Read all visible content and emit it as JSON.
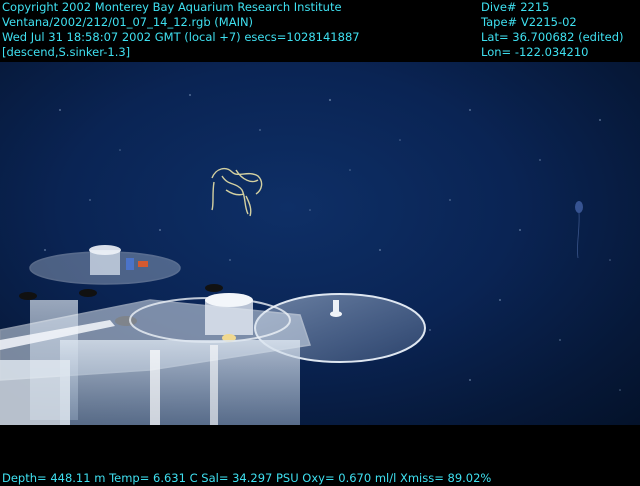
{
  "header_left": {
    "line1": "Copyright 2002 Monterey Bay Aquarium Research Institute",
    "line2": "Ventana/2002/212/01_07_14_12.rgb (MAIN)",
    "line3": "Wed Jul 31 18:58:07 2002 GMT (local +7)  esecs=1028141887",
    "line4": "[descend,S.sinker-1.3]"
  },
  "header_right": {
    "dive": "Dive# 2215",
    "tape": "Tape# V2215-02",
    "lat": "Lat= 36.700682 (edited)",
    "lon": "Lon= -122.034210"
  },
  "footer": {
    "telemetry": "Depth= 448.11 m  Temp= 6.631 C  Sal= 34.297 PSU  Oxy= 0.670 ml/l  Xmiss= 89.02%"
  },
  "colors": {
    "hud_text": "#3fe0f0",
    "water": "#0a2454",
    "frame": "#000000"
  }
}
